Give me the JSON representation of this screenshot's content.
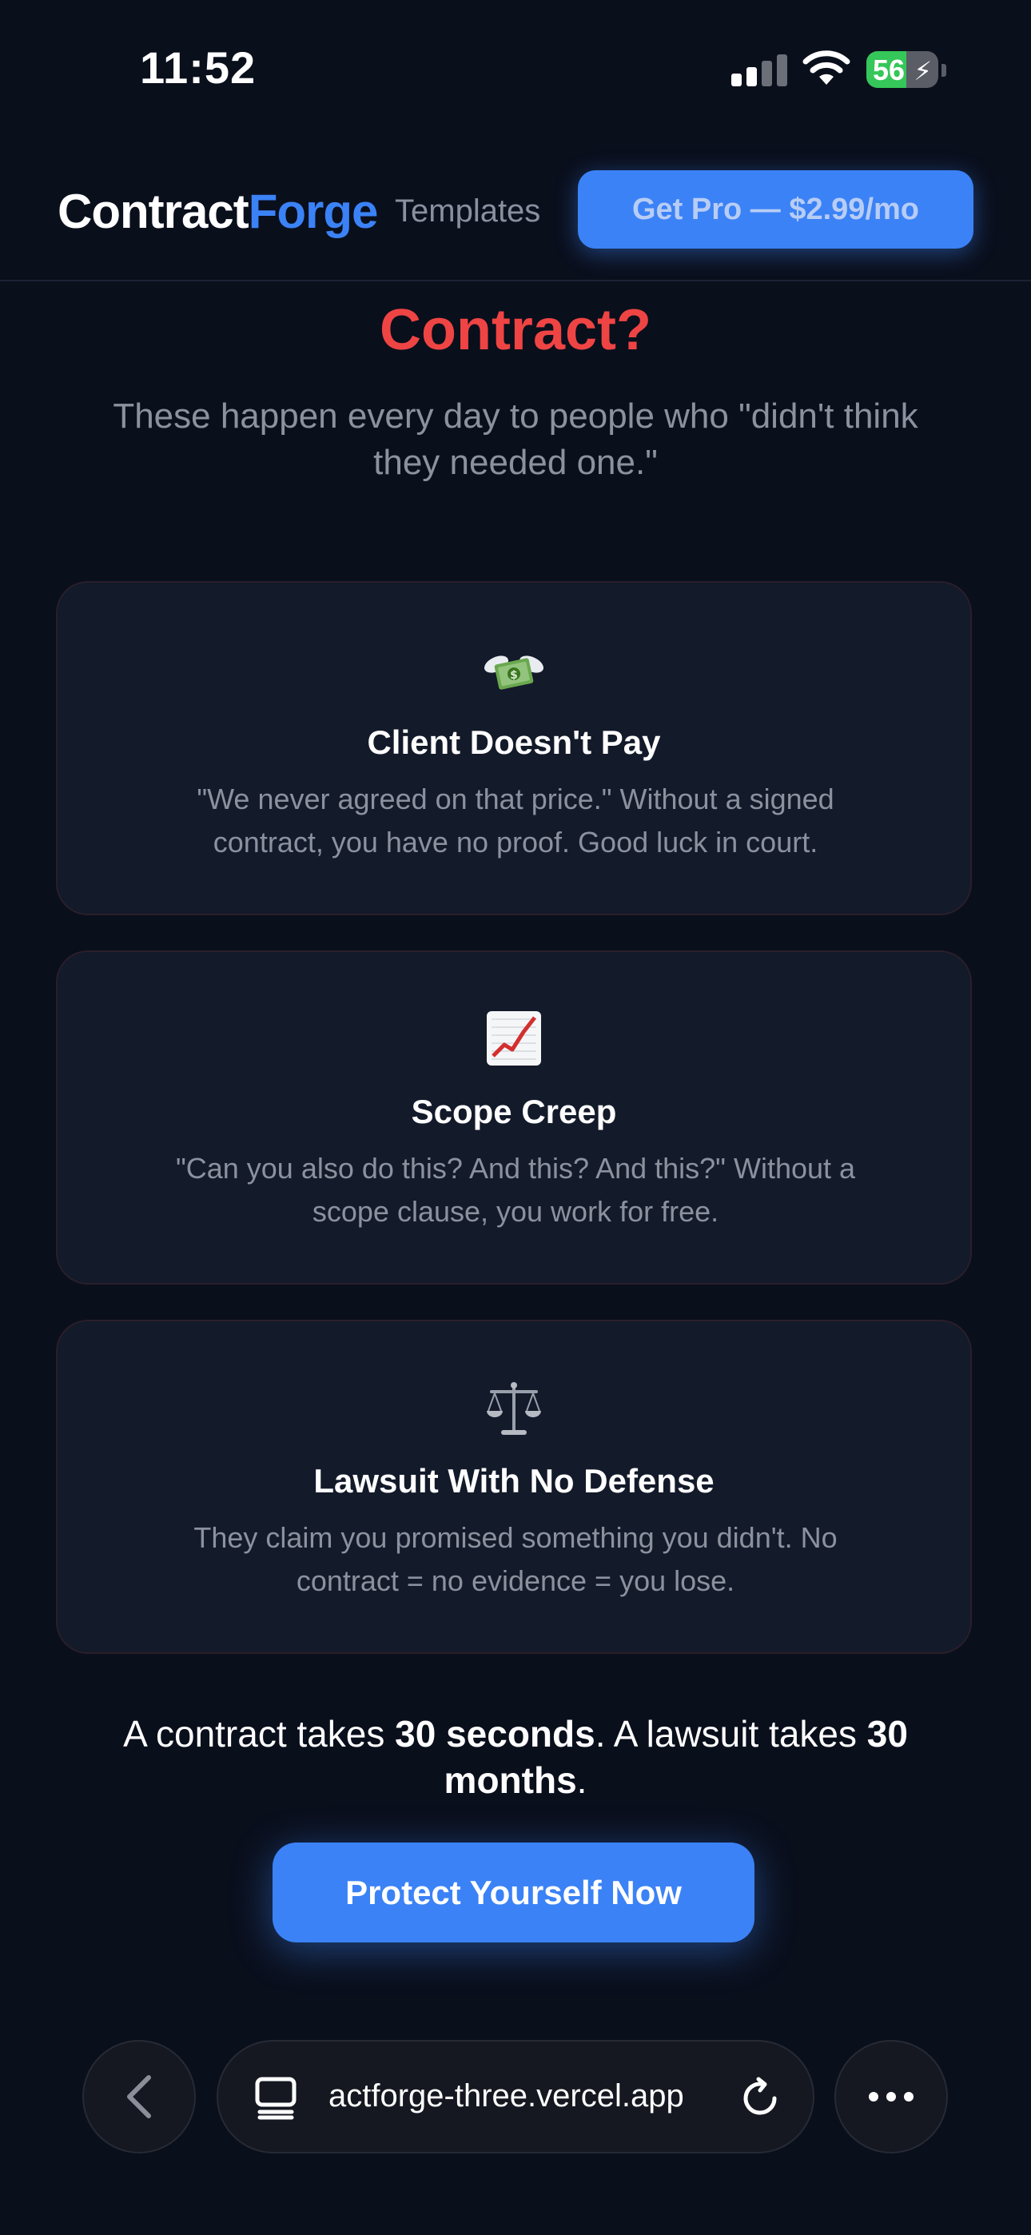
{
  "status_bar": {
    "time": "11:52",
    "battery_percent": "56",
    "battery_level": 0.56
  },
  "header": {
    "logo_part1": "Contract",
    "logo_part2": "Forge",
    "nav_templates": "Templates",
    "get_pro_label": "Get Pro — $2.99/mo"
  },
  "hero": {
    "heading_line2": "Contract?",
    "subheading": "These happen every day to people who \"didn't think they needed one.\""
  },
  "cards": [
    {
      "icon": "money-with-wings-icon",
      "title": "Client Doesn't Pay",
      "description": "\"We never agreed on that price.\" Without a signed contract, you have no proof. Good luck in court."
    },
    {
      "icon": "chart-increasing-icon",
      "title": "Scope Creep",
      "description": "\"Can you also do this? And this? And this?\" Without a scope clause, you work for free."
    },
    {
      "icon": "balance-scale-icon",
      "title": "Lawsuit With No Defense",
      "description": "They claim you promised something you didn't. No contract = no evidence = you lose."
    }
  ],
  "comparison": {
    "part1": "A contract takes ",
    "bold1": "30 seconds",
    "part2": ". A lawsuit takes ",
    "bold2": "30 months",
    "part3": "."
  },
  "cta": {
    "label": "Protect Yourself Now"
  },
  "browser": {
    "url_text": "actforge-three.vercel.app"
  },
  "colors": {
    "background": "#0a0f1c",
    "accent": "#3b82f6",
    "danger": "#ef4444",
    "card": "#131a2a",
    "muted": "#8c919e"
  }
}
